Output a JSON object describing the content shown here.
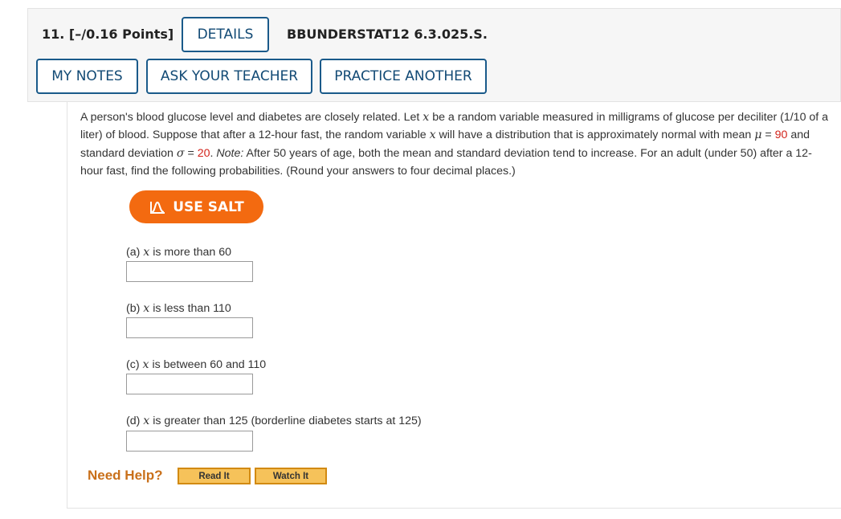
{
  "question": {
    "number_points": "11.  [–/0.16 Points]",
    "details_label": "DETAILS",
    "id": "BBUNDERSTAT12 6.3.025.S.",
    "my_notes_label": "MY NOTES",
    "ask_teacher_label": "ASK YOUR TEACHER",
    "practice_another_label": "PRACTICE ANOTHER"
  },
  "problem": {
    "t1": "A person's blood glucose level and diabetes are closely related. Let ",
    "x1": "x",
    "t2": " be a random variable measured in milligrams of glucose per deciliter (1/10 of a liter) of blood. Suppose that after a 12-hour fast, the random variable ",
    "x2": "x",
    "t3": " will have a distribution that is approximately normal with mean ",
    "mu": "μ",
    "eq1": " = ",
    "mu_val": "90",
    "t4": " and standard deviation ",
    "sigma": "σ",
    "eq2": " = ",
    "sigma_val": "20",
    "t5": ". ",
    "note": "Note:",
    "t6": " After 50 years of age, both the mean and standard deviation tend to increase. For an adult (under 50) after a 12-hour fast, find the following probabilities. (Round your answers to four decimal places.)"
  },
  "salt": {
    "label": "USE SALT",
    "icon": "salt-distribution-icon"
  },
  "parts": [
    {
      "prefix": "(a) ",
      "var": "x",
      "text": " is more than 60",
      "value": ""
    },
    {
      "prefix": "(b) ",
      "var": "x",
      "text": " is less than 110",
      "value": ""
    },
    {
      "prefix": "(c) ",
      "var": "x",
      "text": " is between 60 and 110",
      "value": ""
    },
    {
      "prefix": "(d) ",
      "var": "x",
      "text": " is greater than 125 (borderline diabetes starts at 125)",
      "value": ""
    }
  ],
  "help": {
    "label": "Need Help?",
    "read_it": "Read It",
    "watch_it": "Watch It"
  },
  "colors": {
    "accent_blue": "#124a75",
    "salt_orange": "#f36a10",
    "value_red": "#d2231b",
    "help_orange": "#c9701a"
  }
}
